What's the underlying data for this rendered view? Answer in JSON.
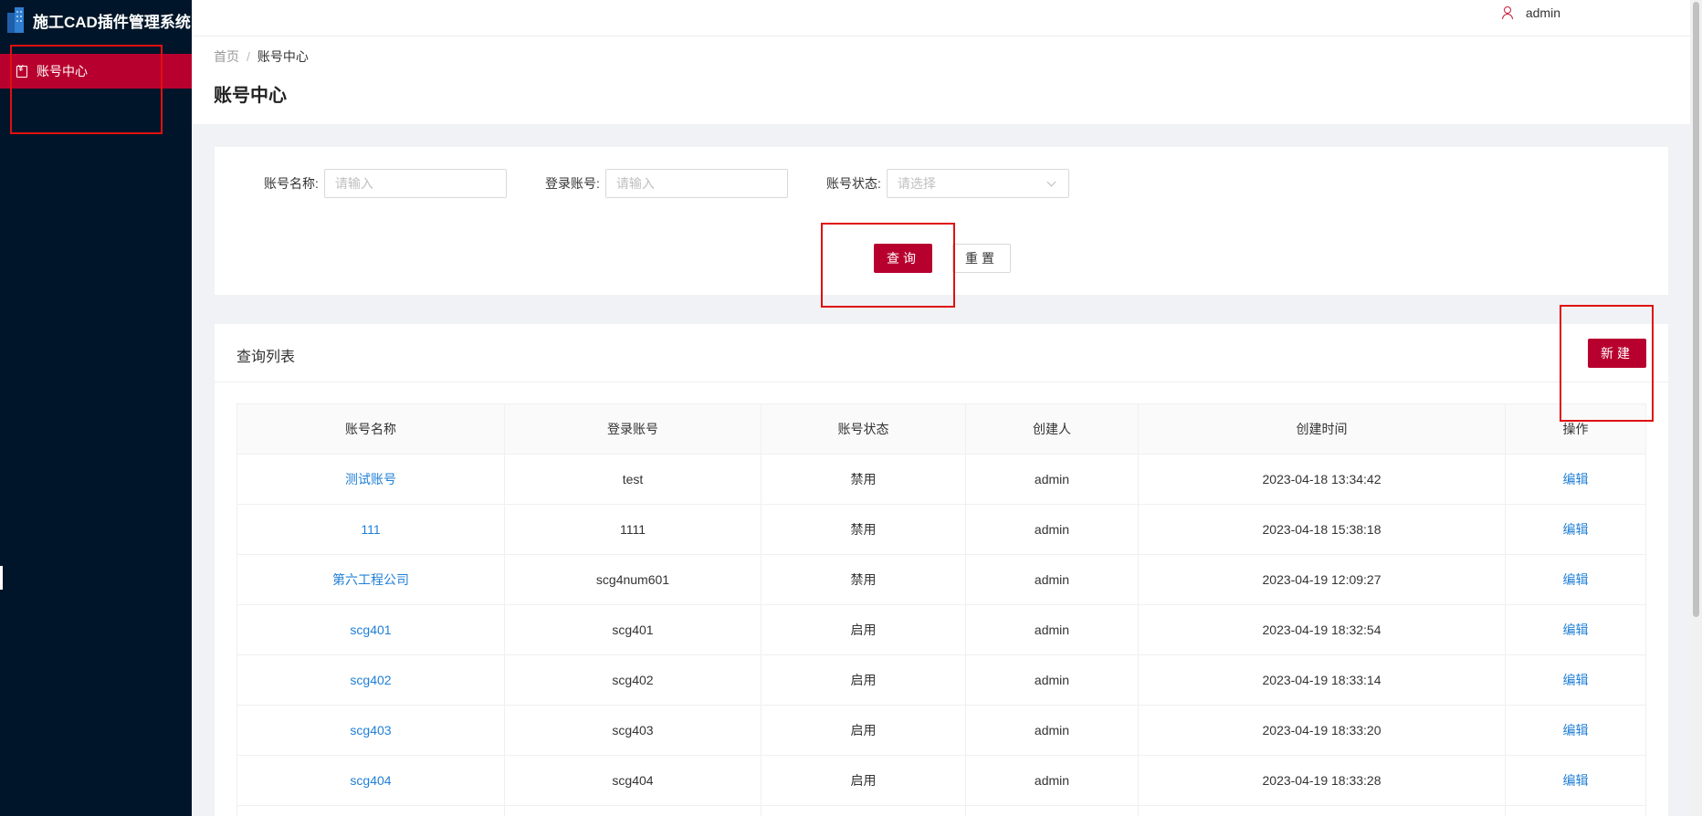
{
  "app": {
    "title": "施工CAD插件管理系统"
  },
  "sidebar": {
    "items": [
      {
        "label": "账号中心",
        "icon": "account-card-icon"
      }
    ]
  },
  "header": {
    "user": "admin"
  },
  "breadcrumb": {
    "home": "首页",
    "sep": "/",
    "current": "账号中心"
  },
  "page": {
    "title": "账号中心"
  },
  "search": {
    "name_label": "账号名称:",
    "name_placeholder": "请输入",
    "login_label": "登录账号:",
    "login_placeholder": "请输入",
    "status_label": "账号状态:",
    "status_placeholder": "请选择",
    "query_button": "查询",
    "reset_button": "重置"
  },
  "list": {
    "title": "查询列表",
    "new_button": "新建",
    "columns": [
      "账号名称",
      "登录账号",
      "账号状态",
      "创建人",
      "创建时间",
      "操作"
    ],
    "rows": [
      {
        "name": "测试账号",
        "login": "test",
        "status": "禁用",
        "creator": "admin",
        "created": "2023-04-18 13:34:42",
        "op": "编辑"
      },
      {
        "name": "111",
        "login": "1111",
        "status": "禁用",
        "creator": "admin",
        "created": "2023-04-18 15:38:18",
        "op": "编辑"
      },
      {
        "name": "第六工程公司",
        "login": "scg4num601",
        "status": "禁用",
        "creator": "admin",
        "created": "2023-04-19 12:09:27",
        "op": "编辑"
      },
      {
        "name": "scg401",
        "login": "scg401",
        "status": "启用",
        "creator": "admin",
        "created": "2023-04-19 18:32:54",
        "op": "编辑"
      },
      {
        "name": "scg402",
        "login": "scg402",
        "status": "启用",
        "creator": "admin",
        "created": "2023-04-19 18:33:14",
        "op": "编辑"
      },
      {
        "name": "scg403",
        "login": "scg403",
        "status": "启用",
        "creator": "admin",
        "created": "2023-04-19 18:33:20",
        "op": "编辑"
      },
      {
        "name": "scg404",
        "login": "scg404",
        "status": "启用",
        "creator": "admin",
        "created": "2023-04-19 18:33:28",
        "op": "编辑"
      }
    ]
  },
  "colors": {
    "primary": "#b8002e",
    "sidebar_bg": "#001529",
    "link": "#1f7fd6",
    "annotation": "#e01010"
  }
}
